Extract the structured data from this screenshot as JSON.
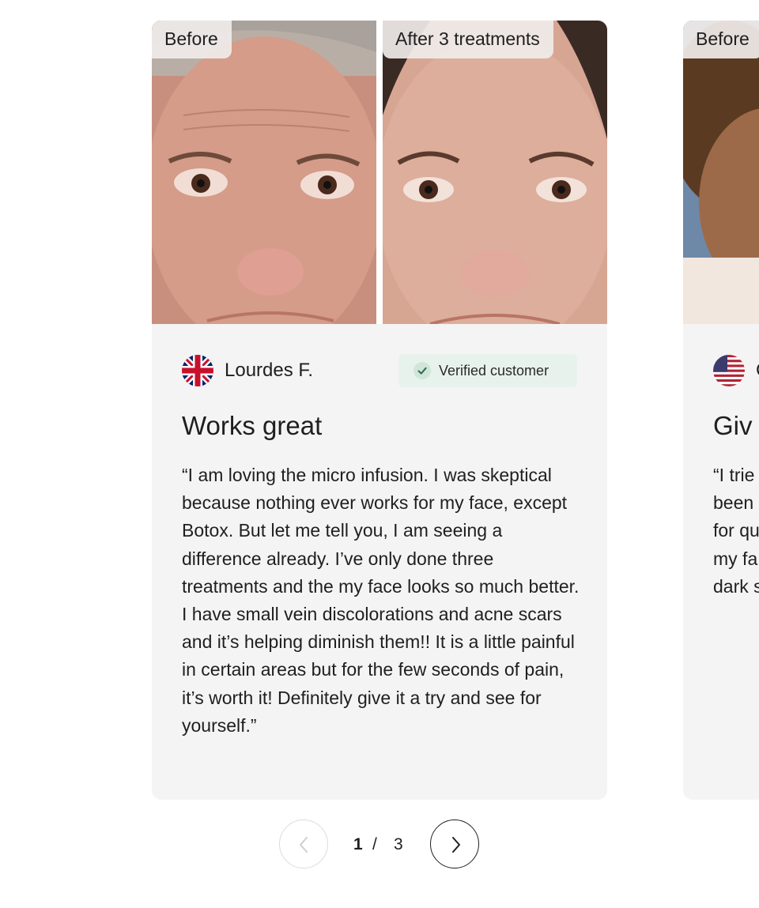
{
  "carousel": {
    "slides": [
      {
        "before_label": "Before",
        "after_label": "After 3 treatments",
        "reviewer_name": "Lourdes F.",
        "country_flag_icon": "uk-flag-icon",
        "verified_label": "Verified customer",
        "title": "Works great",
        "body": "“I am loving the micro infusion. I was skeptical because nothing ever works for my face, except Botox. But let me tell you, I am seeing a difference already. I’ve only done three treatments and the my face looks so much better. I have small vein discolorations and acne scars and it’s helping diminish them!! It is a little painful in certain areas but for the few seconds of pain, it’s worth it! Definitely give it a try and see for yourself.”"
      },
      {
        "before_label": "Before",
        "reviewer_initial": "C",
        "country_flag_icon": "us-flag-icon",
        "title_partial": "Giv",
        "body_partial_lines": [
          "“I trie",
          "been",
          "for qu",
          "my fa",
          "dark s"
        ]
      }
    ],
    "pagination": {
      "current": "1",
      "separator": "/",
      "total": "3",
      "prev_icon": "chevron-left-icon",
      "next_icon": "chevron-right-icon"
    }
  },
  "colors": {
    "card_background": "#f4f4f4",
    "verified_badge_background": "#e8f2ec",
    "check_color": "#2f6b4a",
    "text": "#1f1f1f",
    "prev_button_border": "#dcdcdc",
    "next_button_border": "#1f1f1f"
  }
}
